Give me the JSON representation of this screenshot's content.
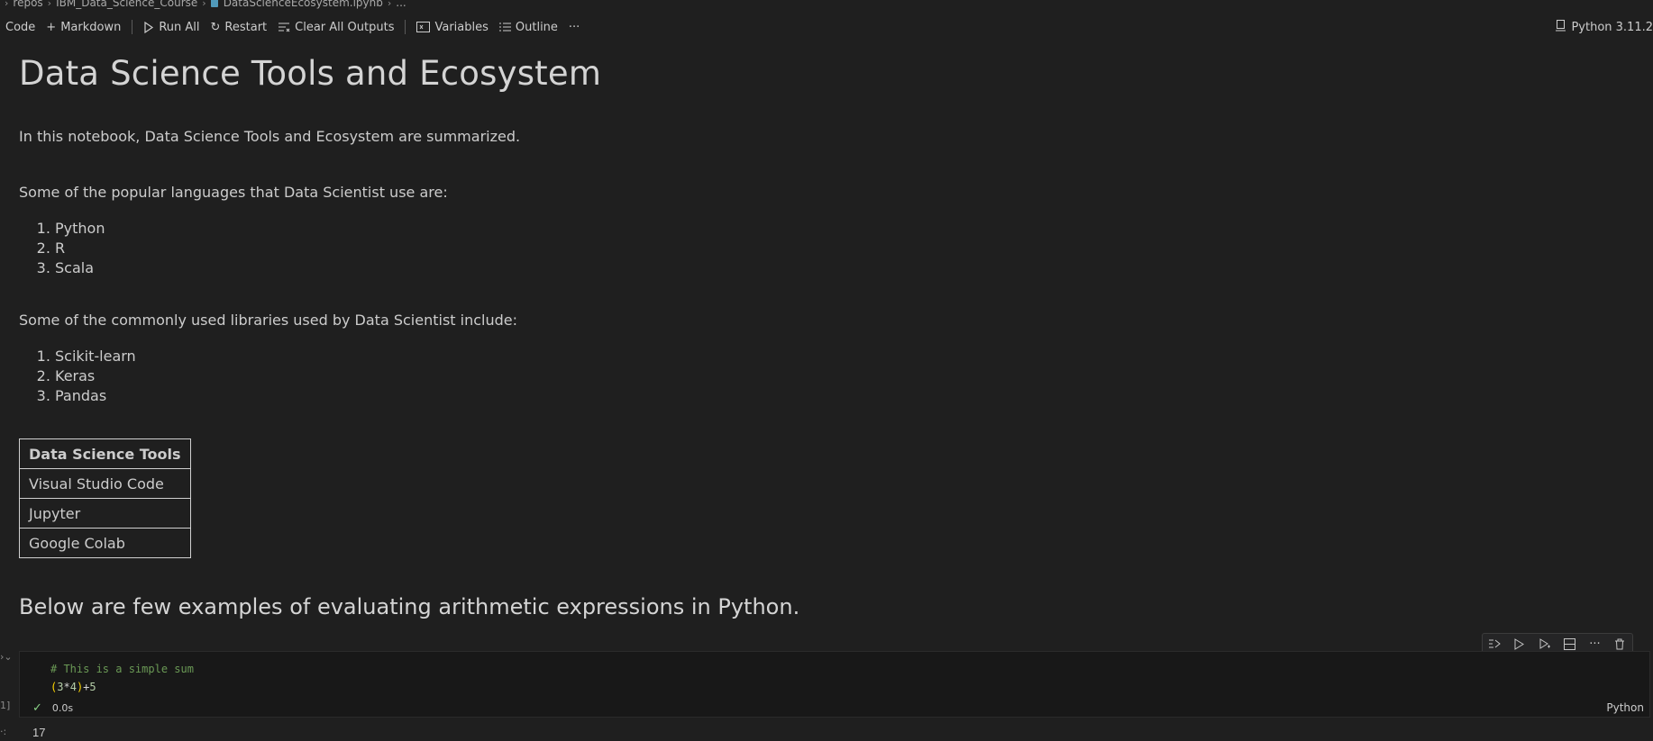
{
  "breadcrumb": {
    "items": [
      "repos",
      "IBM_Data_Science_Course",
      "DataScienceEcosystem.ipynb",
      "..."
    ]
  },
  "toolbar": {
    "code_label": "Code",
    "markdown_label": "Markdown",
    "run_all_label": "Run All",
    "restart_label": "Restart",
    "clear_label": "Clear All Outputs",
    "variables_label": "Variables",
    "outline_label": "Outline",
    "more_label": "···",
    "kernel_label": "Python 3.11.2"
  },
  "notebook": {
    "title": "Data Science Tools and Ecosystem",
    "intro": "In this notebook, Data Science Tools and Ecosystem are summarized.",
    "languages_heading": "Some of the popular languages that Data Scientist use are:",
    "languages": [
      "Python",
      "R",
      "Scala"
    ],
    "libraries_heading": "Some of the commonly used libraries used by Data Scientist include:",
    "libraries": [
      "Scikit-learn",
      "Keras",
      "Pandas"
    ],
    "table": {
      "header": "Data Science Tools",
      "rows": [
        "Visual Studio Code",
        "Jupyter",
        "Google Colab"
      ]
    },
    "examples_heading": "Below are few examples of evaluating arithmetic expressions in Python."
  },
  "code_cell": {
    "comment": "# This is a simple sum",
    "code_open": "(",
    "code_a": "3",
    "code_op1": "*",
    "code_b": "4",
    "code_close": ")",
    "code_op2": "+",
    "code_c": "5",
    "duration": "0.0s",
    "language": "Python",
    "exec_count": "1]",
    "output": "17"
  }
}
